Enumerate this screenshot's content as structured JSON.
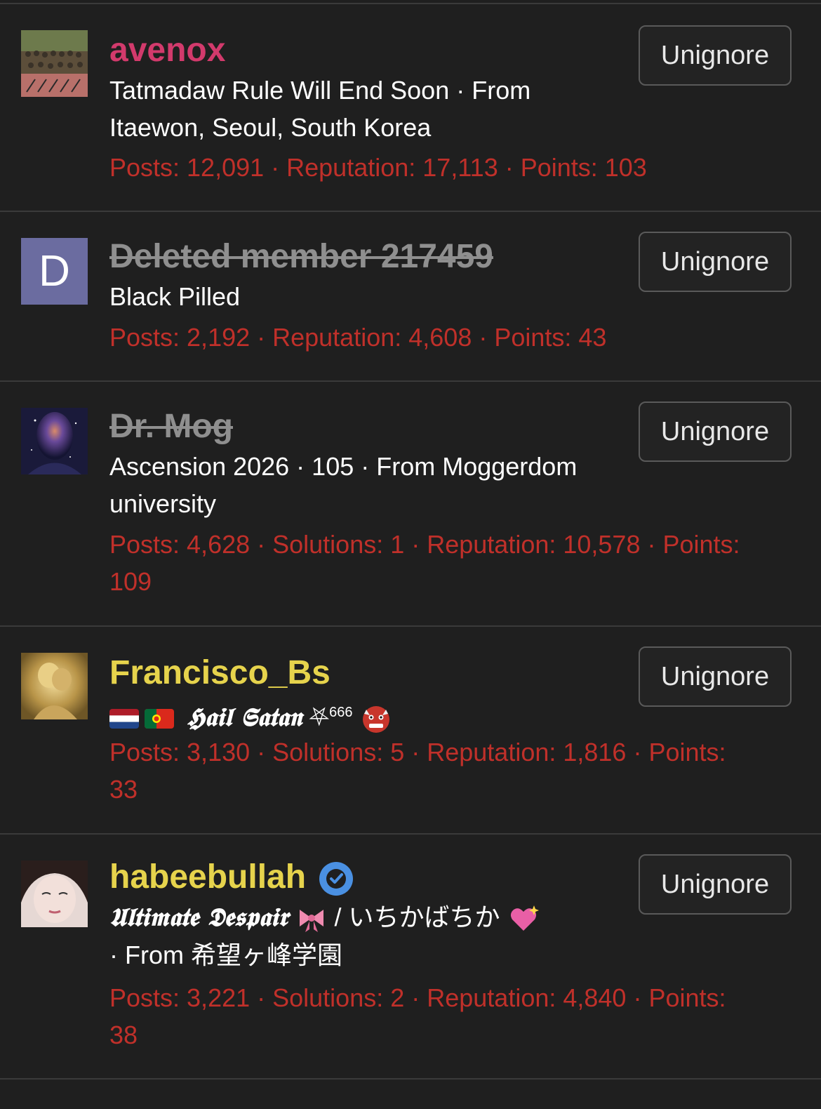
{
  "button_label": "Unignore",
  "members": [
    {
      "username": "avenox",
      "avatar_icon": "group-photo-avatar",
      "title_line1": "Tatmadaw Rule Will End Soon · From",
      "title_line2": "Itaewon, Seoul, South Korea",
      "stats_line1": "Posts: 12,091 · Reputation: 17,113 · Points: 103"
    },
    {
      "username": "Deleted member 217459",
      "avatar_letter": "D",
      "title_line1": "Black Pilled",
      "stats_line1": "Posts: 2,192 · Reputation: 4,608 · Points: 43"
    },
    {
      "username": "Dr. Mog",
      "avatar_icon": "galaxy-face-avatar",
      "title_line1": "Ascension 2026 · 105 · From Moggerdom",
      "title_line2": "university",
      "stats_line1": "Posts: 4,628 · Solutions: 1 · Reputation: 10,578 · Points:",
      "stats_line2": "109"
    },
    {
      "username": "Francisco_Bs",
      "avatar_icon": "golden-statue-avatar",
      "title_text": "𝕳𝖆𝖎𝖑 𝕾𝖆𝖙𝖆𝖓",
      "title_star": "⛧",
      "title_sup": "666",
      "stats_line1": "Posts: 3,130 · Solutions: 5 · Reputation: 1,816 · Points:",
      "stats_line2": "33"
    },
    {
      "username": "habeebullah",
      "avatar_icon": "anime-girl-avatar",
      "title_text": "𝖀𝖑𝖙𝖎𝖒𝖆𝖙𝖊 𝕯𝖊𝖘𝖕𝖆𝖎𝖗",
      "title_mid": " / いちかばちか ",
      "title_line2": "· From 希望ヶ峰学園",
      "stats_line1": "Posts: 3,221 · Solutions: 2 · Reputation: 4,840 · Points:",
      "stats_line2": "38"
    }
  ],
  "colors": {
    "background": "#1f1f1f",
    "stats_red": "#c0302a",
    "username_pink": "#d23a6c",
    "username_gold": "#e6d34c",
    "deleted_grey": "#8f8f8f",
    "verified_blue": "#4a90e2"
  }
}
